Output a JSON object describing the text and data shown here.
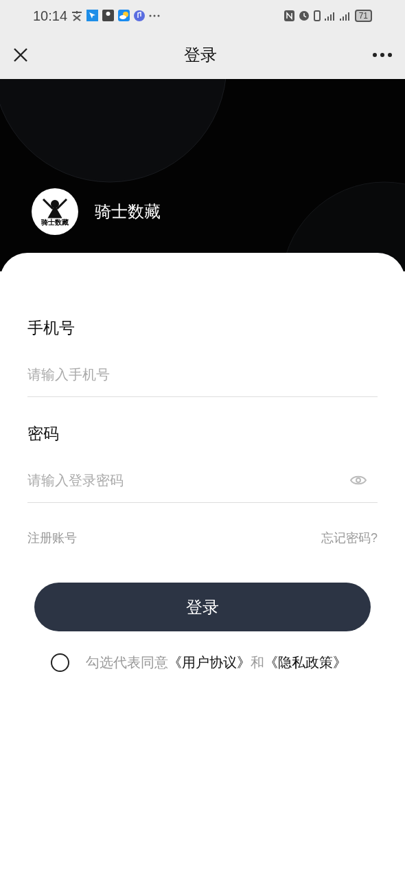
{
  "status_bar": {
    "time": "10:14",
    "battery": "71"
  },
  "nav_bar": {
    "title": "登录"
  },
  "brand": {
    "logo_text": "骑士数藏",
    "name": "骑士数藏"
  },
  "form": {
    "fields": [
      {
        "label": "手机号",
        "placeholder": "请输入手机号",
        "kind": "text"
      },
      {
        "label": "密码",
        "placeholder": "请输入登录密码",
        "kind": "password"
      }
    ],
    "register_link": "注册账号",
    "forgot_link": "忘记密码?",
    "submit": "登录"
  },
  "agreement": {
    "checked": false,
    "text": "勾选代表同意",
    "link_1": "《用户协议》",
    "joiner": "和",
    "link_2": "《隐私政策》"
  }
}
